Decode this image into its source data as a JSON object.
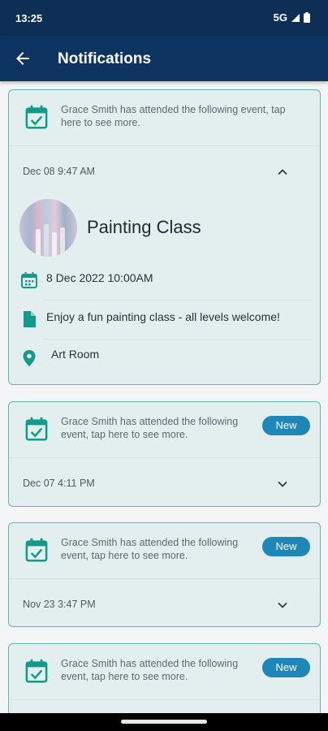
{
  "status_bar": {
    "time": "13:25",
    "network": "5G"
  },
  "app_bar": {
    "title": "Notifications"
  },
  "notifications": [
    {
      "message": "Grace Smith has attended the following event, tap here to see more.",
      "date": "Dec 08 9:47 AM",
      "expanded": true,
      "event": {
        "title": "Painting Class",
        "datetime": "8 Dec 2022 10:00AM",
        "description": "Enjoy a fun painting class - all levels welcome!",
        "location": "Art Room"
      }
    },
    {
      "message": "Grace Smith has attended the following event, tap here to see more.",
      "badge": "New",
      "date": "Dec 07 4:11 PM",
      "expanded": false
    },
    {
      "message": "Grace Smith has attended the following event, tap here to see more.",
      "badge": "New",
      "date": "Nov 23 3:47 PM",
      "expanded": false
    },
    {
      "message": "Grace Smith has attended the following event, tap here to see more.",
      "badge": "New",
      "expanded": false
    }
  ],
  "colors": {
    "app_bar": "#0d3360",
    "status_bar": "#0d2f55",
    "accent": "#139a8a",
    "badge": "#1f86b8",
    "card_bg": "#e3efee",
    "card_border": "#63b7a9"
  }
}
